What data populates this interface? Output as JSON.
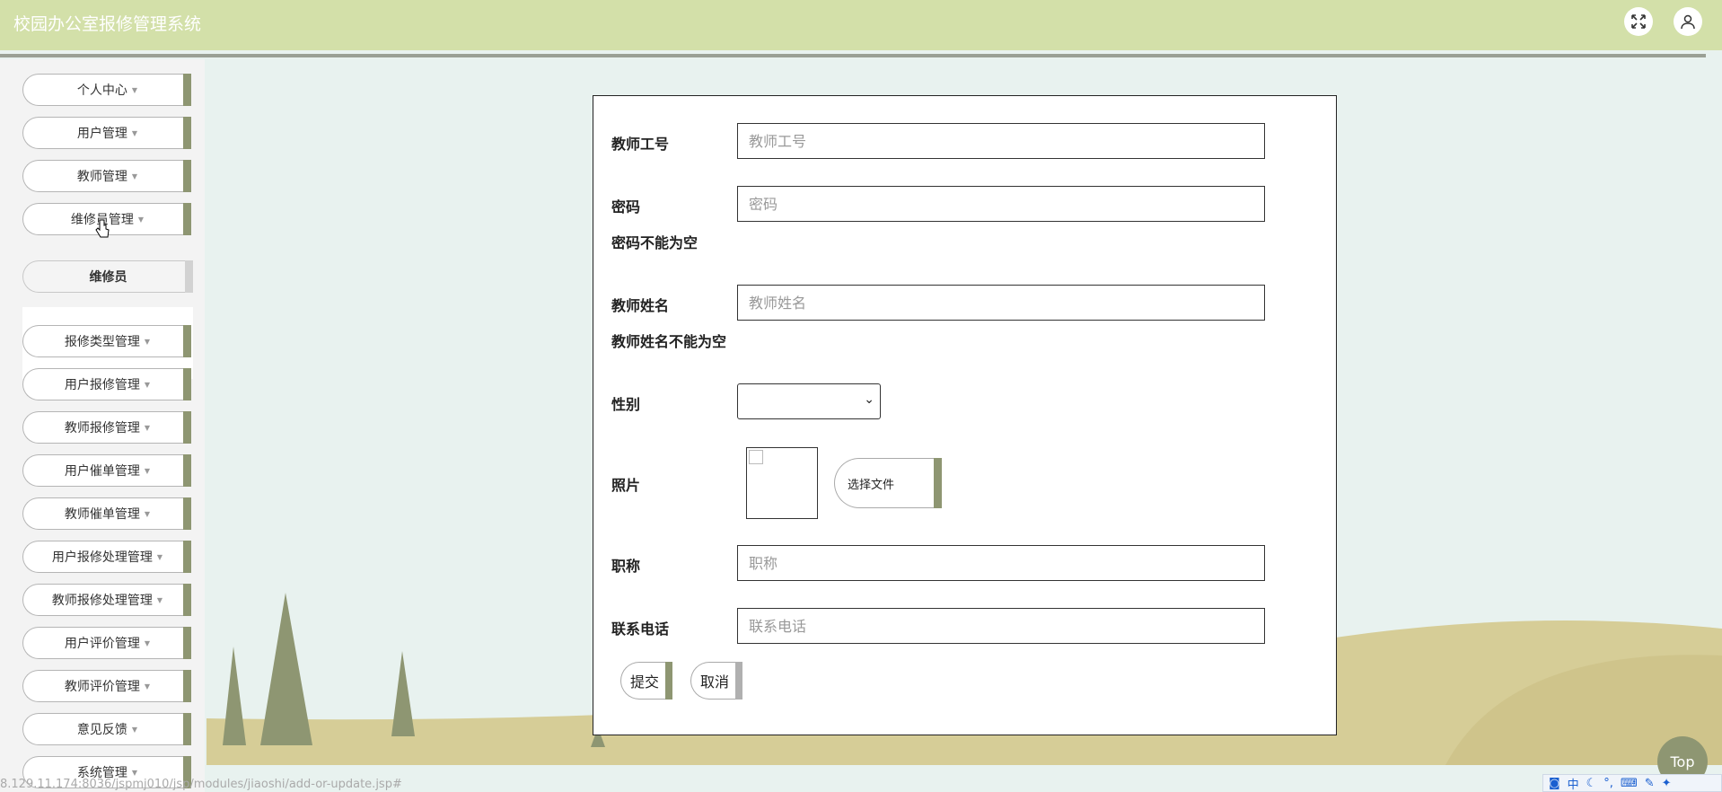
{
  "header": {
    "title": "校园办公室报修管理系统",
    "fullscreen_icon": "fullscreen-icon",
    "user_icon": "user-icon"
  },
  "sidebar": {
    "items": [
      {
        "label": "个人中心"
      },
      {
        "label": "用户管理"
      },
      {
        "label": "教师管理"
      },
      {
        "label": "维修员管理"
      },
      {
        "label": "报修类型管理"
      },
      {
        "label": "用户报修管理"
      },
      {
        "label": "教师报修管理"
      },
      {
        "label": "用户催单管理"
      },
      {
        "label": "教师催单管理"
      },
      {
        "label": "用户报修处理管理"
      },
      {
        "label": "教师报修处理管理"
      },
      {
        "label": "用户评价管理"
      },
      {
        "label": "教师评价管理"
      },
      {
        "label": "意见反馈"
      },
      {
        "label": "系统管理"
      }
    ],
    "submenu": {
      "label": "维修员"
    }
  },
  "form": {
    "teacher_id": {
      "label": "教师工号",
      "placeholder": "教师工号",
      "value": ""
    },
    "password": {
      "label": "密码",
      "placeholder": "密码",
      "value": "",
      "error": "密码不能为空"
    },
    "teacher_name": {
      "label": "教师姓名",
      "placeholder": "教师姓名",
      "value": "",
      "error": "教师姓名不能为空"
    },
    "gender": {
      "label": "性别",
      "value": ""
    },
    "photo": {
      "label": "照片",
      "choose_file": "选择文件"
    },
    "title_field": {
      "label": "职称",
      "placeholder": "职称",
      "value": ""
    },
    "phone": {
      "label": "联系电话",
      "placeholder": "联系电话",
      "value": ""
    },
    "submit": "提交",
    "cancel": "取消"
  },
  "top_button": "Top",
  "status_url": "8.129.11.174:8036/jspmj010/jsp/modules/jiaoshi/add-or-update.jsp#",
  "ime": {
    "mode": "中"
  },
  "colors": {
    "header": "#d3e0a9",
    "accent": "#8e9672",
    "background": "#e8f2ef"
  }
}
